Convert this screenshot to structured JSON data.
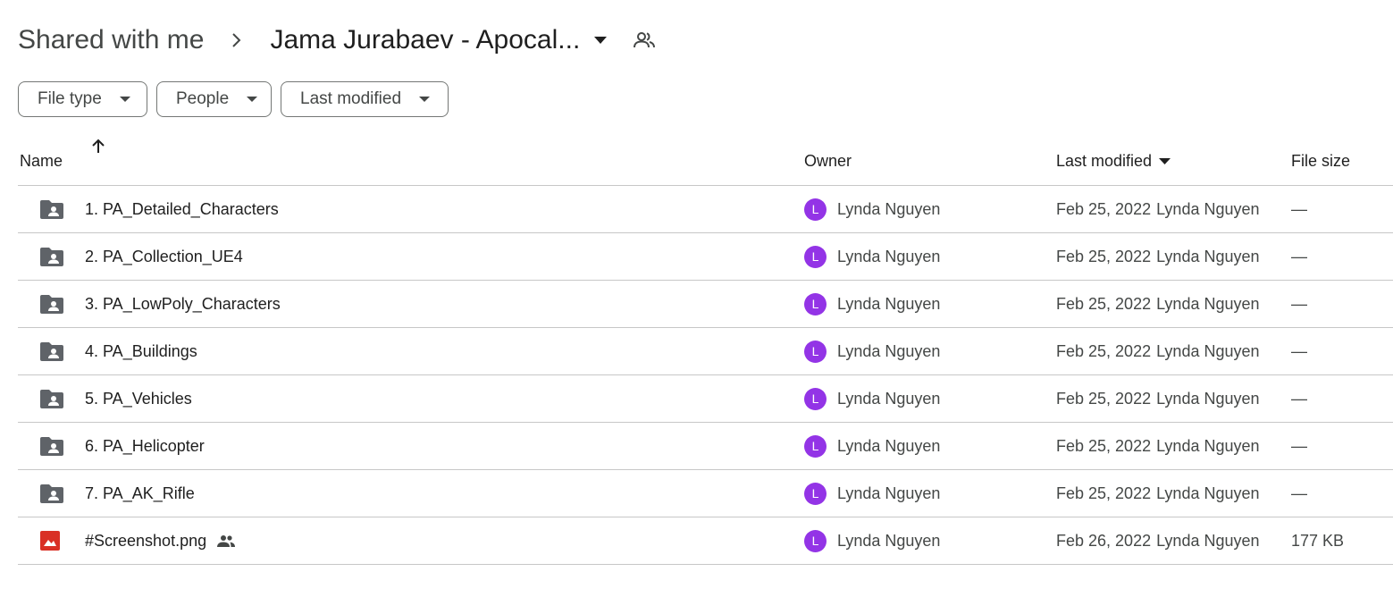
{
  "breadcrumb": {
    "root": "Shared with me",
    "current": "Jama Jurabaev - Apocal..."
  },
  "filters": [
    {
      "label": "File type"
    },
    {
      "label": "People"
    },
    {
      "label": "Last modified"
    }
  ],
  "columns": {
    "name": "Name",
    "owner": "Owner",
    "last_modified": "Last modified",
    "file_size": "File size"
  },
  "rows": [
    {
      "icon": "shared-folder-icon",
      "name": "1. PA_Detailed_Characters",
      "owner_initial": "L",
      "owner": "Lynda Nguyen",
      "date": "Feb 25, 2022",
      "modified_by": "Lynda Nguyen",
      "size": "—"
    },
    {
      "icon": "shared-folder-icon",
      "name": "2. PA_Collection_UE4",
      "owner_initial": "L",
      "owner": "Lynda Nguyen",
      "date": "Feb 25, 2022",
      "modified_by": "Lynda Nguyen",
      "size": "—"
    },
    {
      "icon": "shared-folder-icon",
      "name": "3. PA_LowPoly_Characters",
      "owner_initial": "L",
      "owner": "Lynda Nguyen",
      "date": "Feb 25, 2022",
      "modified_by": "Lynda Nguyen",
      "size": "—"
    },
    {
      "icon": "shared-folder-icon",
      "name": "4. PA_Buildings",
      "owner_initial": "L",
      "owner": "Lynda Nguyen",
      "date": "Feb 25, 2022",
      "modified_by": "Lynda Nguyen",
      "size": "—"
    },
    {
      "icon": "shared-folder-icon",
      "name": "5. PA_Vehicles",
      "owner_initial": "L",
      "owner": "Lynda Nguyen",
      "date": "Feb 25, 2022",
      "modified_by": "Lynda Nguyen",
      "size": "—"
    },
    {
      "icon": "shared-folder-icon",
      "name": "6. PA_Helicopter",
      "owner_initial": "L",
      "owner": "Lynda Nguyen",
      "date": "Feb 25, 2022",
      "modified_by": "Lynda Nguyen",
      "size": "—"
    },
    {
      "icon": "shared-folder-icon",
      "name": "7. PA_AK_Rifle",
      "owner_initial": "L",
      "owner": "Lynda Nguyen",
      "date": "Feb 25, 2022",
      "modified_by": "Lynda Nguyen",
      "size": "—"
    },
    {
      "icon": "image-file-icon",
      "name": "#Screenshot.png",
      "owner_initial": "L",
      "owner": "Lynda Nguyen",
      "date": "Feb 26, 2022",
      "modified_by": "Lynda Nguyen",
      "size": "177 KB",
      "shared": true
    }
  ],
  "colors": {
    "avatar": "#9334e6",
    "image_icon": "#d93025",
    "folder_icon": "#5f6368"
  }
}
